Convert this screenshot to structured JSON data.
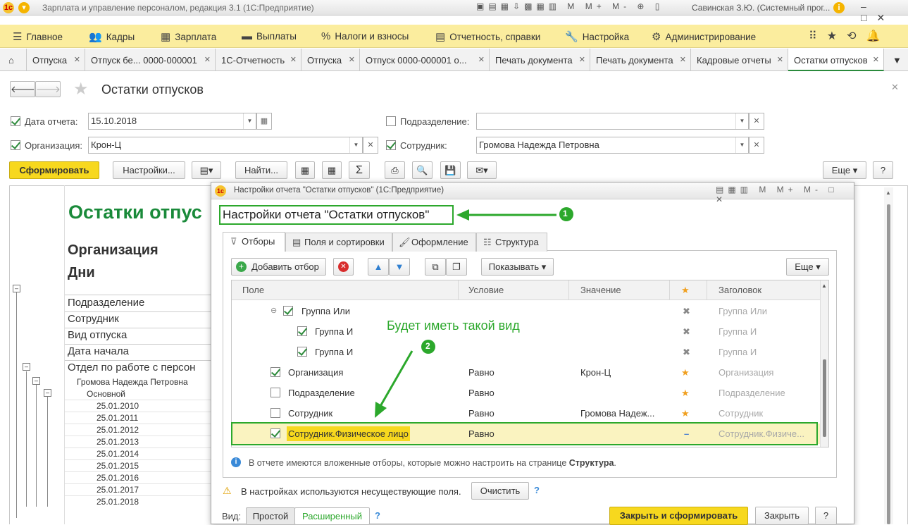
{
  "window": {
    "title": "Зарплата и управление персоналом, редакция 3.1  (1С:Предприятие)",
    "user": "Савинская З.Ю. (Системный прог..."
  },
  "menu": [
    {
      "icon": "menu-icon",
      "label": "Главное"
    },
    {
      "icon": "people-icon",
      "label": "Кадры"
    },
    {
      "icon": "calculator-icon",
      "label": "Зарплата"
    },
    {
      "icon": "wallet-icon",
      "label": "Выплаты"
    },
    {
      "icon": "percent-icon",
      "label": "Налоги и взносы"
    },
    {
      "icon": "reports-icon",
      "label": "Отчетность, справки"
    },
    {
      "icon": "wrench-icon",
      "label": "Настройка"
    },
    {
      "icon": "gear-icon",
      "label": "Администрирование"
    }
  ],
  "tabs": [
    "Отпуска",
    "Отпуск бе... 0000-000001",
    "1С-Отчетность",
    "Отпуска",
    "Отпуск 0000-000001 о...",
    "Печать документа",
    "Печать документа",
    "Кадровые отчеты",
    "Остатки отпусков"
  ],
  "page": {
    "title": "Остатки отпусков"
  },
  "filters": {
    "date_label": "Дата отчета:",
    "date_value": "15.10.2018",
    "org_label": "Организация:",
    "org_value": "Крон-Ц",
    "dept_label": "Подразделение:",
    "dept_value": "",
    "emp_label": "Сотрудник:",
    "emp_value": "Громова Надежда Петровна"
  },
  "toolbar": {
    "generate": "Сформировать",
    "settings": "Настройки...",
    "find": "Найти...",
    "more": "Еще"
  },
  "report": {
    "title": "Остатки отпус",
    "header1": "Организация",
    "header2": "Дни",
    "fields": [
      "Подразделение",
      "Сотрудник",
      "Вид отпуска",
      "Дата начала",
      "Отдел по работе с персон"
    ],
    "employee": "Громова Надежда Петровна",
    "vacation_type": "Основной",
    "dates": [
      "25.01.2010",
      "25.01.2011",
      "25.01.2012",
      "25.01.2013",
      "25.01.2014",
      "25.01.2015",
      "25.01.2016",
      "25.01.2017",
      "25.01.2018"
    ]
  },
  "dialog": {
    "window_title": "Настройки отчета \"Остатки отпусков\"  (1С:Предприятие)",
    "heading": "Настройки отчета \"Остатки отпусков\"",
    "tabs": [
      "Отборы",
      "Поля и сортировки",
      "Оформление",
      "Структура"
    ],
    "add_filter": "Добавить отбор",
    "show": "Показывать",
    "more": "Еще",
    "columns": [
      "Поле",
      "Условие",
      "Значение",
      "Заголовок"
    ],
    "rows": [
      {
        "field": "Группа Или",
        "condition": "",
        "value": "",
        "title": "Группа Или",
        "checked": true
      },
      {
        "field": "Группа И",
        "condition": "",
        "value": "",
        "title": "Группа И",
        "checked": true
      },
      {
        "field": "Группа И",
        "condition": "",
        "value": "",
        "title": "Группа И",
        "checked": true
      },
      {
        "field": "Организация",
        "condition": "Равно",
        "value": "Крон-Ц",
        "title": "Организация",
        "checked": true
      },
      {
        "field": "Подразделение",
        "condition": "Равно",
        "value": "",
        "title": "Подразделение",
        "checked": false
      },
      {
        "field": "Сотрудник",
        "condition": "Равно",
        "value": "Громова Надеж...",
        "title": "Сотрудник",
        "checked": false
      },
      {
        "field": "Сотрудник.Физическое лицо",
        "condition": "Равно",
        "value": "",
        "title": "Сотрудник.Физиче...",
        "checked": true
      }
    ],
    "info_text": "В отчете имеются вложенные отборы, которые можно настроить на странице",
    "info_link": "Структура",
    "warning": "В настройках используются несуществующие поля.",
    "clear": "Очистить",
    "view_label": "Вид:",
    "view_simple": "Простой",
    "view_extended": "Расширенный",
    "close_generate": "Закрыть и сформировать",
    "close": "Закрыть",
    "annotation_1": "1",
    "annotation_2": "2",
    "annotation_text": "Будет иметь такой вид"
  },
  "colors": {
    "accent": "#2ca82c",
    "menu_bg": "#fbed9e",
    "primary_btn": "#f7d81e"
  }
}
